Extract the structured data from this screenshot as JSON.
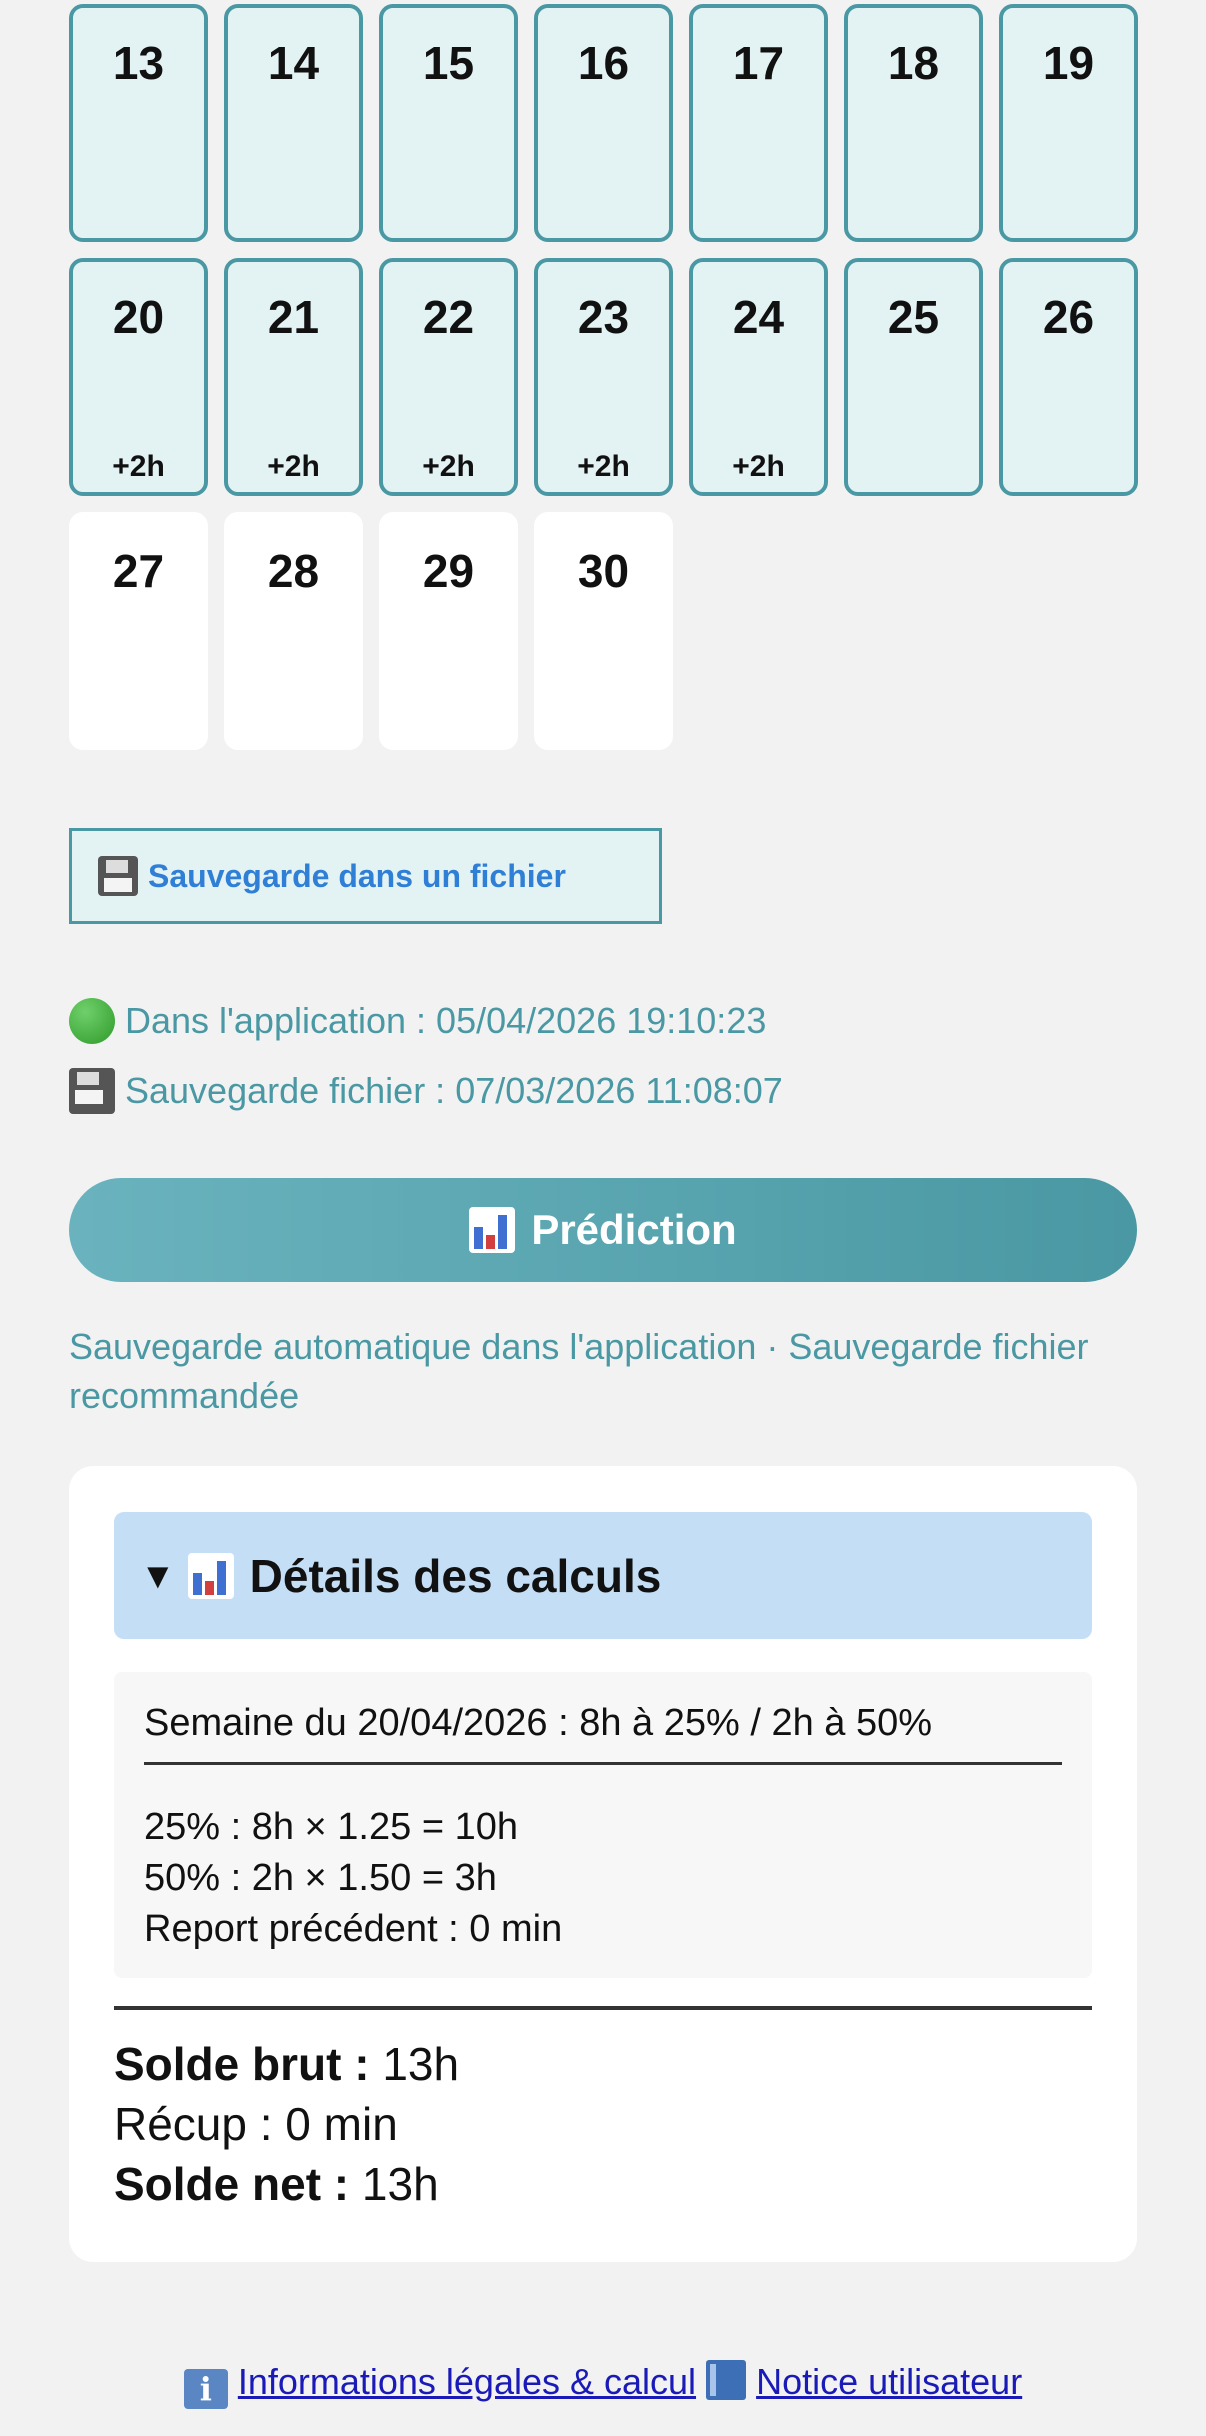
{
  "calendar": {
    "rows": [
      [
        {
          "day": "13",
          "extra": "",
          "marked": true
        },
        {
          "day": "14",
          "extra": "",
          "marked": true
        },
        {
          "day": "15",
          "extra": "",
          "marked": true
        },
        {
          "day": "16",
          "extra": "",
          "marked": true
        },
        {
          "day": "17",
          "extra": "",
          "marked": true
        },
        {
          "day": "18",
          "extra": "",
          "marked": true
        },
        {
          "day": "19",
          "extra": "",
          "marked": true
        }
      ],
      [
        {
          "day": "20",
          "extra": "+2h",
          "marked": true
        },
        {
          "day": "21",
          "extra": "+2h",
          "marked": true
        },
        {
          "day": "22",
          "extra": "+2h",
          "marked": true
        },
        {
          "day": "23",
          "extra": "+2h",
          "marked": true
        },
        {
          "day": "24",
          "extra": "+2h",
          "marked": true
        },
        {
          "day": "25",
          "extra": "",
          "marked": true
        },
        {
          "day": "26",
          "extra": "",
          "marked": true
        }
      ],
      [
        {
          "day": "27",
          "extra": "",
          "marked": false
        },
        {
          "day": "28",
          "extra": "",
          "marked": false
        },
        {
          "day": "29",
          "extra": "",
          "marked": false
        },
        {
          "day": "30",
          "extra": "",
          "marked": false
        }
      ]
    ]
  },
  "save_file_button": {
    "label": "Sauvegarde dans un fichier",
    "icon": "floppy-disk-icon"
  },
  "status": {
    "app_save": "Dans l'application : 05/04/2026 19:10:23",
    "file_save": "Sauvegarde fichier : 07/03/2026 11:08:07"
  },
  "prediction_button": {
    "label": "Prédiction",
    "icon": "bar-chart-icon"
  },
  "auto_note": "Sauvegarde automatique dans l'application · Sauvegarde fichier recommandée",
  "details": {
    "summary_toggle": "▼",
    "summary_title": "Détails des calculs",
    "week": "Semaine du 20/04/2026 : 8h à 25% / 2h à 50%",
    "line_25": "25% : 8h × 1.25 = 10h",
    "line_50": "50% : 2h × 1.50 = 3h",
    "report": "Report précédent : 0 min",
    "brut_label": "Solde brut :",
    "brut_value": " 13h",
    "recup": "Récup : 0 min",
    "net_label": "Solde net :",
    "net_value": " 13h"
  },
  "footer": {
    "legal_link": "Informations légales & calcul",
    "notice_link": "Notice utilisateur"
  },
  "colors": {
    "accent": "#4a98a3",
    "marked_bg": "#e3f3f4",
    "link_blue": "#2f7fd6",
    "summary_bg": "#c4def6"
  }
}
